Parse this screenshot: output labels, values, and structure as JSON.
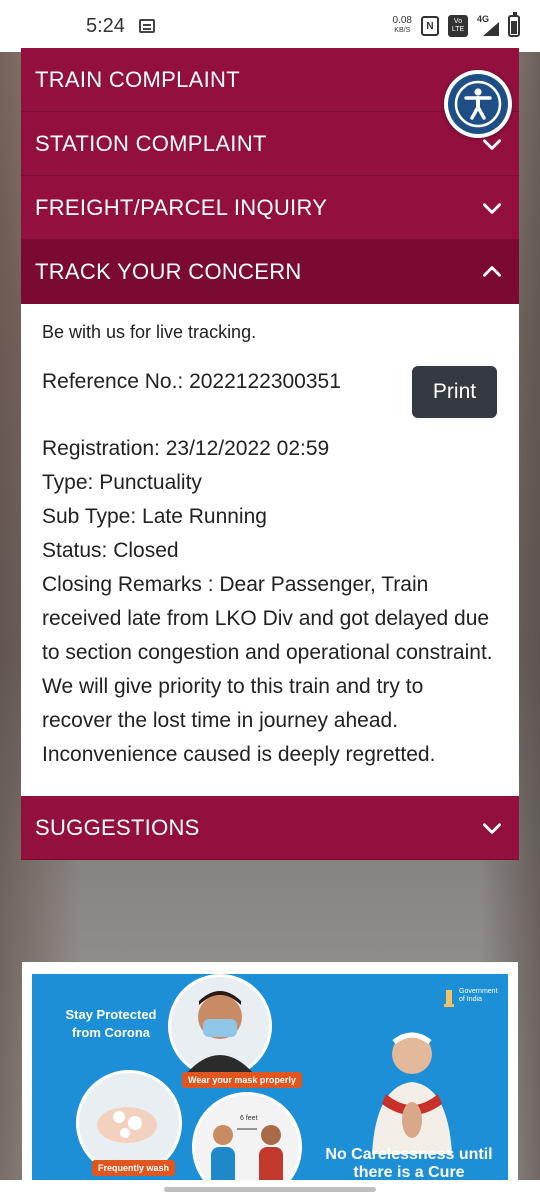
{
  "status_bar": {
    "time": "5:24",
    "net_speed": "0.08",
    "net_unit": "KB/S",
    "nfc_label": "N",
    "volte_label": "Vo LTE",
    "signal_label": "4G",
    "signal_sub": "R"
  },
  "accordion": {
    "sections": [
      {
        "label": "TRAIN COMPLAINT"
      },
      {
        "label": "STATION COMPLAINT"
      },
      {
        "label": "FREIGHT/PARCEL INQUIRY"
      },
      {
        "label": "TRACK YOUR CONCERN"
      },
      {
        "label": "SUGGESTIONS"
      }
    ],
    "active_index": 3
  },
  "concern": {
    "intro": "Be with us for live tracking.",
    "reference": "Reference No.: 2022122300351",
    "print_label": "Print",
    "registration": "Registration: 23/12/2022 02:59",
    "type": "Type: Punctuality",
    "sub_type": "Sub Type: Late Running",
    "status": "Status: Closed",
    "closing_remarks": "Closing Remarks : Dear Passenger, Train received late from LKO Div and got delayed due to section congestion and operational constraint. We will give priority to this train and try to recover the lost time in journey ahead. Inconvenience caused is deeply regretted."
  },
  "banner": {
    "title": "Stay Protected from Corona",
    "mask_tag": "Wear your mask properly",
    "wash_tag": "Frequently wash",
    "distance_tag": "6 feet",
    "gov_label": "Government of India",
    "bottom_text": "No Carelessness until there is a Cure"
  },
  "colors": {
    "accordion": "#93103e",
    "accordion_active": "#7a0a32",
    "print_button": "#343a40",
    "a11y_button": "#1d4f86",
    "banner_bg": "#1d8fd6"
  },
  "icons": {
    "accordion_closed": "chevron-down-icon",
    "accordion_open": "chevron-up-icon",
    "accessibility": "accessibility-person-icon"
  }
}
